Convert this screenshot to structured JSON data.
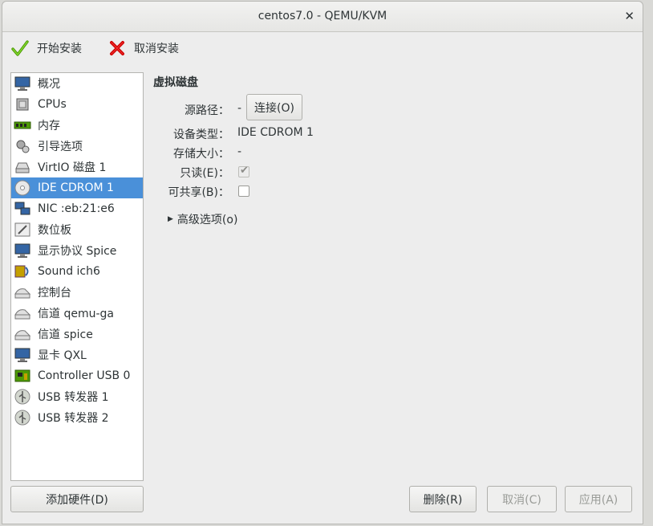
{
  "window": {
    "title": "centos7.0 - QEMU/KVM"
  },
  "toolbar": {
    "begin_install": "开始安装",
    "cancel_install": "取消安装"
  },
  "sidebar": {
    "items": [
      {
        "label": "概况",
        "icon": "monitor-icon"
      },
      {
        "label": "CPUs",
        "icon": "cpu-icon"
      },
      {
        "label": "内存",
        "icon": "memory-icon"
      },
      {
        "label": "引导选项",
        "icon": "boot-options-icon"
      },
      {
        "label": "VirtIO 磁盘 1",
        "icon": "disk-icon"
      },
      {
        "label": "IDE CDROM 1",
        "icon": "cdrom-icon",
        "selected": true
      },
      {
        "label": "NIC :eb:21:e6",
        "icon": "network-icon"
      },
      {
        "label": "数位板",
        "icon": "tablet-icon"
      },
      {
        "label": "显示协议 Spice",
        "icon": "display-icon"
      },
      {
        "label": "Sound ich6",
        "icon": "sound-icon"
      },
      {
        "label": "控制台",
        "icon": "serial-icon"
      },
      {
        "label": "信道 qemu-ga",
        "icon": "channel-icon"
      },
      {
        "label": "信道 spice",
        "icon": "channel-icon"
      },
      {
        "label": "显卡 QXL",
        "icon": "video-card-icon"
      },
      {
        "label": "Controller USB 0",
        "icon": "controller-icon"
      },
      {
        "label": "USB 转发器 1",
        "icon": "usb-redirector-icon"
      },
      {
        "label": "USB 转发器 2",
        "icon": "usb-redirector-icon"
      }
    ],
    "add_hardware": "添加硬件(D)"
  },
  "details": {
    "section_title": "虚拟磁盘",
    "source_path_label": "源路径：",
    "source_path_value": "-",
    "connect_button": "连接(O)",
    "device_type_label": "设备类型：",
    "device_type_value": "IDE CDROM 1",
    "storage_size_label": "存储大小：",
    "storage_size_value": "-",
    "readonly_label": "只读(E)：",
    "readonly_checked": true,
    "shareable_label": "可共享(B)：",
    "shareable_checked": false,
    "advanced_options": "高级选项(o)"
  },
  "buttons": {
    "remove": "删除(R)",
    "cancel": "取消(C)",
    "apply": "应用(A)"
  },
  "colors": {
    "selection": "#4a90d9",
    "check_green": "#4e9a06",
    "cancel_red": "#cc0000"
  }
}
